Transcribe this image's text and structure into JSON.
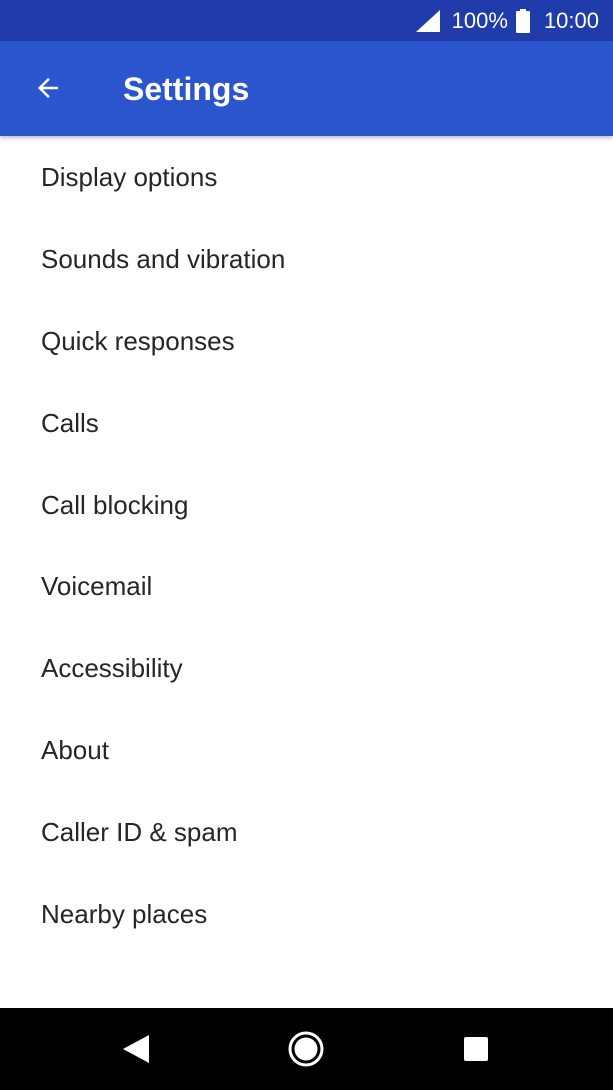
{
  "status_bar": {
    "battery_percent": "100%",
    "time": "10:00",
    "icons": [
      "signal-icon",
      "battery-icon"
    ]
  },
  "app_bar": {
    "title": "Settings",
    "back_icon": "arrow-back-icon"
  },
  "settings": {
    "items": [
      {
        "label": "Display options"
      },
      {
        "label": "Sounds and vibration"
      },
      {
        "label": "Quick responses"
      },
      {
        "label": "Calls"
      },
      {
        "label": "Call blocking"
      },
      {
        "label": "Voicemail"
      },
      {
        "label": "Accessibility"
      },
      {
        "label": "About"
      },
      {
        "label": "Caller ID & spam"
      },
      {
        "label": "Nearby places"
      }
    ]
  },
  "nav_bar": {
    "icons": [
      "nav-back-icon",
      "nav-home-icon",
      "nav-recents-icon"
    ]
  },
  "colors": {
    "status_bar": "#1f3caa",
    "app_bar": "#2a55cc",
    "text": "#262626",
    "nav_bar": "#000000"
  }
}
